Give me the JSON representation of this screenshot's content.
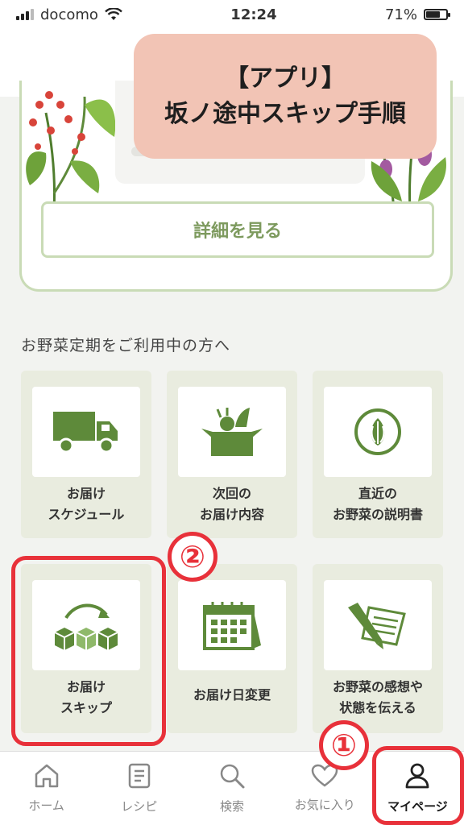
{
  "status_bar": {
    "carrier": "docomo",
    "time": "12:24",
    "battery_text": "71%",
    "battery_level": 0.71
  },
  "overlay": {
    "line1": "【アプリ】",
    "line2": "坂ノ途中スキップ手順"
  },
  "banner": {
    "detail_button": "詳細を見る"
  },
  "section": {
    "heading": "お野菜定期をご利用中の方へ"
  },
  "tiles": [
    {
      "label": "お届け\nスケジュール",
      "icon": "truck-icon"
    },
    {
      "label": "次回の\nお届け内容",
      "icon": "vegetable-box-icon"
    },
    {
      "label": "直近の\nお野菜の説明書",
      "icon": "onion-icon"
    },
    {
      "label": "お届け\nスキップ",
      "icon": "skip-boxes-icon"
    },
    {
      "label": "お届け日変更",
      "icon": "calendar-icon"
    },
    {
      "label": "お野菜の感想や\n状態を伝える",
      "icon": "feedback-pen-icon"
    }
  ],
  "annotations": {
    "step1": "①",
    "step2": "②"
  },
  "tab_bar": {
    "items": [
      {
        "label": "ホーム",
        "icon": "home-icon"
      },
      {
        "label": "レシピ",
        "icon": "recipe-icon"
      },
      {
        "label": "検索",
        "icon": "search-icon"
      },
      {
        "label": "お気に入り",
        "icon": "heart-icon"
      },
      {
        "label": "マイページ",
        "icon": "person-icon"
      }
    ],
    "active_index": 4
  },
  "colors": {
    "accent_green": "#5e8a3a",
    "highlight_red": "#e8313a",
    "overlay_pink": "#f2c4b5"
  }
}
